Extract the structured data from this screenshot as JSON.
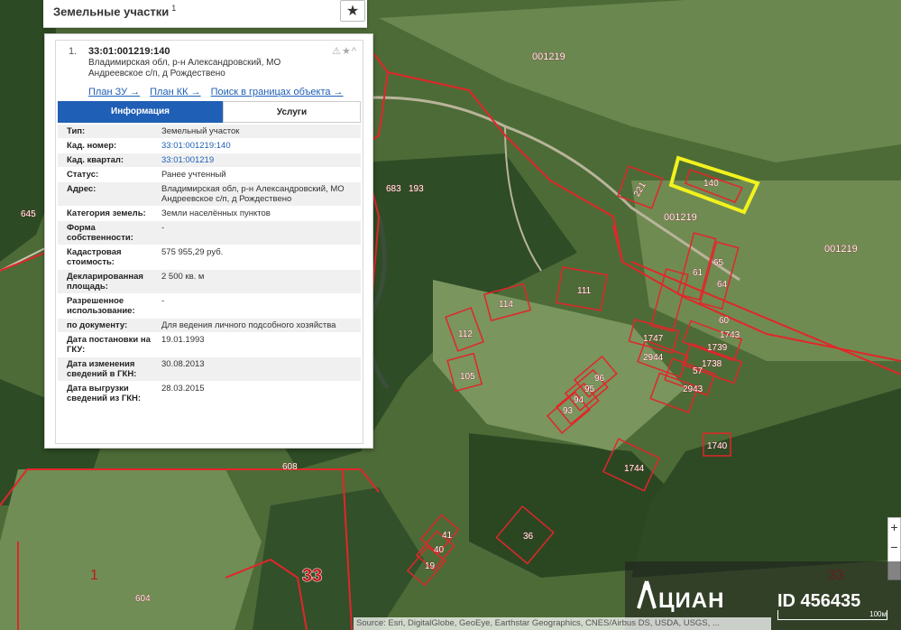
{
  "panel": {
    "title": "Земельные участки",
    "title_sup": "1",
    "star_icon": "star-icon"
  },
  "card": {
    "index": "1.",
    "cad_number": "33:01:001219:140",
    "address": "Владимирская обл, р-н Александровский, МО Андреевское с/п, д Рождествено",
    "icons": "⚠★^",
    "links": [
      "План ЗУ →",
      "План КК →",
      "Поиск в границах объекта →"
    ],
    "tabs": {
      "info": "Информация",
      "services": "Услуги"
    },
    "rows": [
      {
        "k": "Тип:",
        "v": "Земельный участок"
      },
      {
        "k": "Кад. номер:",
        "v": "33:01:001219:140",
        "link": true
      },
      {
        "k": "Кад. квартал:",
        "v": "33:01:001219",
        "link": true
      },
      {
        "k": "Статус:",
        "v": "Ранее учтенный"
      },
      {
        "k": "Адрес:",
        "v": "Владимирская обл, р-н Александровский, МО Андреевское с/п, д Рождествено"
      },
      {
        "k": "Категория земель:",
        "v": "Земли населённых пунктов"
      },
      {
        "k": "Форма собственности:",
        "v": "-"
      },
      {
        "k": "Кадастровая стоимость:",
        "v": "575 955,29 руб."
      },
      {
        "k": "Декларированная площадь:",
        "v": "2 500 кв. м"
      },
      {
        "k": "Разрешенное использование:",
        "v": "-"
      },
      {
        "k": "по документу:",
        "v": "Для ведения личного подсобного хозяйства"
      },
      {
        "k": "Дата постановки на ГКУ:",
        "v": "19.01.1993"
      },
      {
        "k": "Дата изменения сведений в ГКН:",
        "v": "30.08.2013"
      },
      {
        "k": "Дата выгрузки сведений из ГКН:",
        "v": "28.03.2015"
      }
    ]
  },
  "map_labels": {
    "quarter_top": "001219",
    "quarter_mid": "001219",
    "quarter_right": "001219",
    "selected": "140",
    "parcels": [
      "221",
      "683",
      "193",
      "645",
      "114",
      "111",
      "112",
      "105",
      "61",
      "65",
      "64",
      "60",
      "1743",
      "1747",
      "1739",
      "2944",
      "1738",
      "57",
      "2943",
      "96",
      "95",
      "94",
      "93",
      "1740",
      "1744",
      "41",
      "40",
      "19",
      "36",
      "608",
      "604",
      "1",
      "33",
      "33"
    ]
  },
  "zoom": {
    "plus": "+",
    "minus": "−"
  },
  "logo": {
    "brand": "ЦИАН",
    "id": "ID 456435"
  },
  "attribution": "Source: Esri, DigitalGlobe, GeoEye, Earthstar Geographics, CNES/Airbus DS, USDA, USGS, ...",
  "scale_label": "100м",
  "colors": {
    "parcel_border": "#e2262a",
    "selected_border": "#f1f21d",
    "link": "#1f5fb5"
  }
}
